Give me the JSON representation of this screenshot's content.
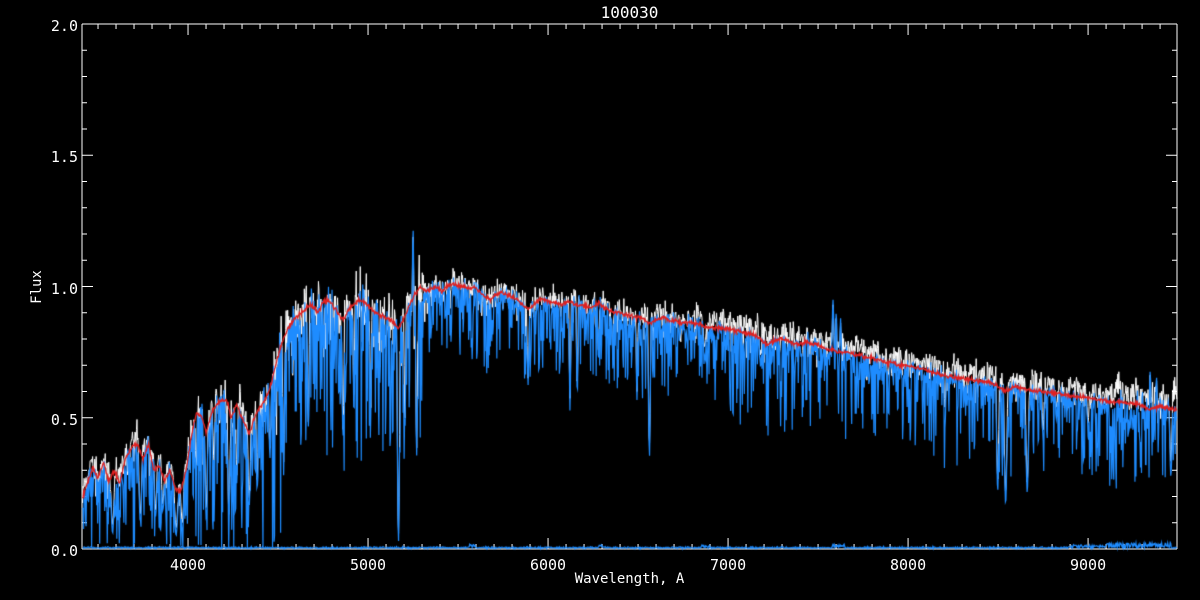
{
  "chart_data": {
    "type": "line",
    "title": "100030",
    "xlabel": "Wavelength, A",
    "ylabel": "Flux",
    "xlim": [
      3411,
      9494
    ],
    "ylim": [
      0.0,
      2.0
    ],
    "x_major_ticks": [
      4000,
      5000,
      6000,
      7000,
      8000,
      9000
    ],
    "x_tick_labels": [
      "4000",
      "5000",
      "6000",
      "7000",
      "8000",
      "9000"
    ],
    "x_minor_step": 100,
    "y_major_ticks": [
      0.0,
      0.5,
      1.0,
      1.5,
      2.0
    ],
    "y_tick_labels": [
      "0.0",
      "0.5",
      "1.0",
      "1.5",
      "2.0"
    ],
    "y_minor_step": 0.1,
    "grid": false,
    "legend": null,
    "colors": {
      "background": "#000000",
      "frame": "#ffffff",
      "text": "#ffffff",
      "observed_spectrum": "#1e8cff",
      "reference_spectrum": "#ffffff",
      "model_fit": "#e02020",
      "noise_floor": "#1e8cff"
    },
    "seed": 42,
    "sample_step_angstrom": 2.8,
    "series": [
      {
        "name": "observed-spectrum-blue",
        "role": "noisy observed spectrum"
      },
      {
        "name": "reference-spectrum-white",
        "role": "comparison spectrum drawn behind"
      },
      {
        "name": "model-fit-red",
        "role": "smooth template fit"
      },
      {
        "name": "noise-floor-blue",
        "role": "error spectrum near zero flux"
      }
    ],
    "continuum_anchors": [
      [
        3411,
        0.19
      ],
      [
        3440,
        0.25
      ],
      [
        3470,
        0.31
      ],
      [
        3500,
        0.27
      ],
      [
        3530,
        0.33
      ],
      [
        3560,
        0.26
      ],
      [
        3590,
        0.3
      ],
      [
        3620,
        0.25
      ],
      [
        3650,
        0.34
      ],
      [
        3690,
        0.39
      ],
      [
        3720,
        0.4
      ],
      [
        3750,
        0.34
      ],
      [
        3780,
        0.4
      ],
      [
        3810,
        0.3
      ],
      [
        3840,
        0.32
      ],
      [
        3870,
        0.26
      ],
      [
        3900,
        0.3
      ],
      [
        3930,
        0.23
      ],
      [
        3960,
        0.22
      ],
      [
        3990,
        0.3
      ],
      [
        4020,
        0.44
      ],
      [
        4050,
        0.52
      ],
      [
        4080,
        0.5
      ],
      [
        4101,
        0.44
      ],
      [
        4130,
        0.52
      ],
      [
        4160,
        0.55
      ],
      [
        4190,
        0.57
      ],
      [
        4220,
        0.56
      ],
      [
        4239,
        0.5
      ],
      [
        4270,
        0.55
      ],
      [
        4300,
        0.5
      ],
      [
        4340,
        0.44
      ],
      [
        4380,
        0.52
      ],
      [
        4420,
        0.56
      ],
      [
        4450,
        0.6
      ],
      [
        4480,
        0.68
      ],
      [
        4510,
        0.76
      ],
      [
        4540,
        0.82
      ],
      [
        4570,
        0.86
      ],
      [
        4600,
        0.88
      ],
      [
        4630,
        0.9
      ],
      [
        4660,
        0.92
      ],
      [
        4690,
        0.93
      ],
      [
        4720,
        0.9
      ],
      [
        4750,
        0.94
      ],
      [
        4780,
        0.95
      ],
      [
        4810,
        0.92
      ],
      [
        4840,
        0.89
      ],
      [
        4861,
        0.87
      ],
      [
        4890,
        0.91
      ],
      [
        4920,
        0.93
      ],
      [
        4950,
        0.95
      ],
      [
        4980,
        0.94
      ],
      [
        5010,
        0.92
      ],
      [
        5040,
        0.9
      ],
      [
        5070,
        0.89
      ],
      [
        5100,
        0.88
      ],
      [
        5130,
        0.87
      ],
      [
        5169,
        0.84
      ],
      [
        5200,
        0.88
      ],
      [
        5230,
        0.93
      ],
      [
        5260,
        0.97
      ],
      [
        5290,
        1.0
      ],
      [
        5320,
        0.98
      ],
      [
        5350,
        0.99
      ],
      [
        5380,
        1.0
      ],
      [
        5410,
        0.98
      ],
      [
        5440,
        1.0
      ],
      [
        5470,
        1.01
      ],
      [
        5500,
        1.0
      ],
      [
        5530,
        1.0
      ],
      [
        5560,
        0.99
      ],
      [
        5590,
        1.0
      ],
      [
        5620,
        0.98
      ],
      [
        5650,
        0.96
      ],
      [
        5680,
        0.95
      ],
      [
        5710,
        0.97
      ],
      [
        5740,
        0.98
      ],
      [
        5770,
        0.97
      ],
      [
        5800,
        0.96
      ],
      [
        5830,
        0.95
      ],
      [
        5860,
        0.93
      ],
      [
        5889,
        0.91
      ],
      [
        5920,
        0.93
      ],
      [
        5950,
        0.95
      ],
      [
        5980,
        0.95
      ],
      [
        6010,
        0.94
      ],
      [
        6040,
        0.94
      ],
      [
        6070,
        0.93
      ],
      [
        6100,
        0.94
      ],
      [
        6130,
        0.94
      ],
      [
        6160,
        0.93
      ],
      [
        6190,
        0.93
      ],
      [
        6220,
        0.92
      ],
      [
        6250,
        0.92
      ],
      [
        6280,
        0.94
      ],
      [
        6310,
        0.92
      ],
      [
        6340,
        0.91
      ],
      [
        6370,
        0.9
      ],
      [
        6400,
        0.9
      ],
      [
        6430,
        0.89
      ],
      [
        6460,
        0.89
      ],
      [
        6490,
        0.88
      ],
      [
        6520,
        0.88
      ],
      [
        6563,
        0.86
      ],
      [
        6590,
        0.87
      ],
      [
        6620,
        0.88
      ],
      [
        6650,
        0.88
      ],
      [
        6680,
        0.87
      ],
      [
        6710,
        0.87
      ],
      [
        6740,
        0.86
      ],
      [
        6770,
        0.86
      ],
      [
        6800,
        0.86
      ],
      [
        6830,
        0.86
      ],
      [
        6860,
        0.85
      ],
      [
        6890,
        0.84
      ],
      [
        6920,
        0.84
      ],
      [
        6950,
        0.84
      ],
      [
        6980,
        0.84
      ],
      [
        7010,
        0.84
      ],
      [
        7040,
        0.83
      ],
      [
        7070,
        0.83
      ],
      [
        7100,
        0.82
      ],
      [
        7130,
        0.82
      ],
      [
        7160,
        0.81
      ],
      [
        7190,
        0.79
      ],
      [
        7220,
        0.78
      ],
      [
        7250,
        0.79
      ],
      [
        7280,
        0.8
      ],
      [
        7310,
        0.8
      ],
      [
        7340,
        0.79
      ],
      [
        7370,
        0.78
      ],
      [
        7400,
        0.78
      ],
      [
        7430,
        0.79
      ],
      [
        7460,
        0.78
      ],
      [
        7490,
        0.78
      ],
      [
        7520,
        0.77
      ],
      [
        7550,
        0.76
      ],
      [
        7580,
        0.76
      ],
      [
        7610,
        0.75
      ],
      [
        7640,
        0.75
      ],
      [
        7670,
        0.75
      ],
      [
        7700,
        0.74
      ],
      [
        7730,
        0.74
      ],
      [
        7760,
        0.73
      ],
      [
        7790,
        0.73
      ],
      [
        7820,
        0.72
      ],
      [
        7850,
        0.72
      ],
      [
        7880,
        0.71
      ],
      [
        7910,
        0.71
      ],
      [
        7940,
        0.7
      ],
      [
        7970,
        0.7
      ],
      [
        8000,
        0.7
      ],
      [
        8050,
        0.69
      ],
      [
        8100,
        0.68
      ],
      [
        8150,
        0.67
      ],
      [
        8200,
        0.66
      ],
      [
        8250,
        0.655
      ],
      [
        8300,
        0.65
      ],
      [
        8350,
        0.645
      ],
      [
        8400,
        0.64
      ],
      [
        8450,
        0.635
      ],
      [
        8500,
        0.62
      ],
      [
        8542,
        0.6
      ],
      [
        8590,
        0.62
      ],
      [
        8640,
        0.61
      ],
      [
        8690,
        0.605
      ],
      [
        8740,
        0.6
      ],
      [
        8790,
        0.595
      ],
      [
        8840,
        0.59
      ],
      [
        8890,
        0.585
      ],
      [
        8940,
        0.58
      ],
      [
        8990,
        0.575
      ],
      [
        9040,
        0.57
      ],
      [
        9090,
        0.565
      ],
      [
        9140,
        0.56
      ],
      [
        9190,
        0.56
      ],
      [
        9240,
        0.555
      ],
      [
        9290,
        0.55
      ],
      [
        9340,
        0.53
      ],
      [
        9390,
        0.545
      ],
      [
        9440,
        0.54
      ],
      [
        9494,
        0.53
      ]
    ],
    "noise_segments": [
      {
        "from": 3411,
        "to": 4000,
        "up": 0.1,
        "down": 1.0,
        "white_offset": 0.03
      },
      {
        "from": 4000,
        "to": 4520,
        "up": 0.09,
        "down": 1.05,
        "white_offset": 0.03
      },
      {
        "from": 4520,
        "to": 5320,
        "up": 0.06,
        "down": 0.62,
        "white_offset": 0.03
      },
      {
        "from": 5320,
        "to": 6520,
        "up": 0.032,
        "down": 0.3,
        "white_offset": 0.02
      },
      {
        "from": 6520,
        "to": 6920,
        "up": 0.04,
        "down": 0.35,
        "white_offset": 0.03
      },
      {
        "from": 6920,
        "to": 8120,
        "up": 0.035,
        "down": 0.42,
        "white_offset": 0.04
      },
      {
        "from": 8120,
        "to": 9120,
        "up": 0.045,
        "down": 0.52,
        "white_offset": 0.04
      },
      {
        "from": 9120,
        "to": 9494,
        "up": 0.085,
        "down": 0.55,
        "white_offset": 0.05
      }
    ],
    "absorption_features": [
      [
        3581,
        0.06,
        14
      ],
      [
        3735,
        0.1,
        12
      ],
      [
        3820,
        0.12,
        10
      ],
      [
        3860,
        0.14,
        10
      ],
      [
        3934,
        0.05,
        14
      ],
      [
        3968,
        0.07,
        12
      ],
      [
        4045,
        0.28,
        8
      ],
      [
        4101,
        0.12,
        10
      ],
      [
        4144,
        0.3,
        8
      ],
      [
        4227,
        0.09,
        10
      ],
      [
        4271,
        0.25,
        8
      ],
      [
        4340,
        0.16,
        10
      ],
      [
        4384,
        0.22,
        8
      ],
      [
        4455,
        0.35,
        8
      ],
      [
        4531,
        0.3,
        8
      ],
      [
        4668,
        0.45,
        8
      ],
      [
        4861,
        0.42,
        9
      ],
      [
        4921,
        0.55,
        7
      ],
      [
        5015,
        0.5,
        7
      ],
      [
        5169,
        0.02,
        10
      ],
      [
        5205,
        0.45,
        7
      ],
      [
        5270,
        0.35,
        8
      ],
      [
        5889,
        0.63,
        9
      ],
      [
        6122,
        0.55,
        7
      ],
      [
        6162,
        0.6,
        7
      ],
      [
        6280,
        0.72,
        7
      ],
      [
        6360,
        0.7,
        6
      ],
      [
        6494,
        0.58,
        7
      ],
      [
        6563,
        0.36,
        9
      ],
      [
        6870,
        0.74,
        12
      ],
      [
        7180,
        0.7,
        8
      ],
      [
        7246,
        0.72,
        7
      ],
      [
        7890,
        0.62,
        7
      ],
      [
        8205,
        0.5,
        8
      ],
      [
        8330,
        0.55,
        7
      ],
      [
        8498,
        0.22,
        10
      ],
      [
        8542,
        0.17,
        12
      ],
      [
        8662,
        0.21,
        12
      ],
      [
        8750,
        0.41,
        9
      ],
      [
        8824,
        0.5,
        8
      ],
      [
        9000,
        0.44,
        9
      ],
      [
        9230,
        0.48,
        8
      ],
      [
        9460,
        0.28,
        10
      ]
    ],
    "emission_spikes": [
      [
        5250,
        1.23,
        5
      ],
      [
        7583,
        0.95,
        7
      ],
      [
        7601,
        0.91,
        5
      ],
      [
        7625,
        0.88,
        5
      ],
      [
        9345,
        0.68,
        6
      ],
      [
        9380,
        0.66,
        5
      ]
    ],
    "noise_floor": {
      "base": 0.005,
      "jitter": 0.003,
      "bumps": [
        [
          5560,
          5600,
          0.012
        ],
        [
          6280,
          6320,
          0.008
        ],
        [
          6850,
          6900,
          0.01
        ],
        [
          7580,
          7650,
          0.014
        ],
        [
          8900,
          9100,
          0.01
        ],
        [
          9100,
          9460,
          0.018
        ]
      ]
    }
  }
}
